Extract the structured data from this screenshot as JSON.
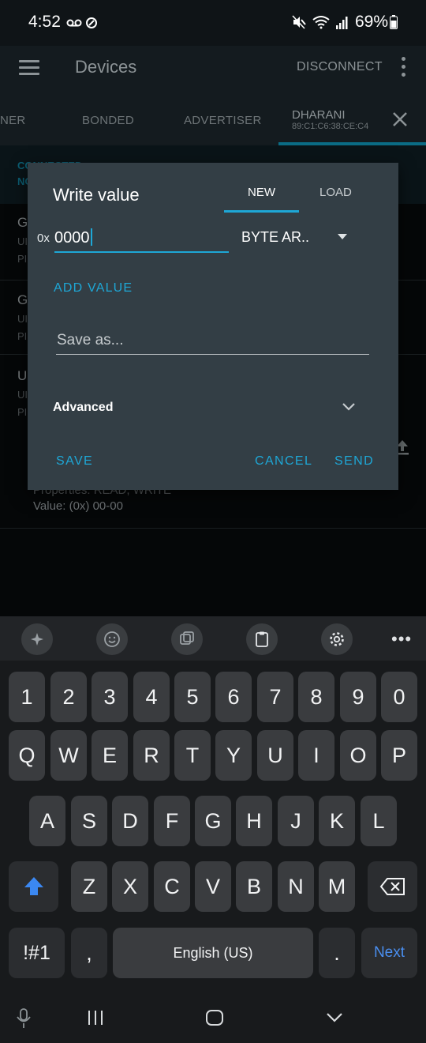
{
  "status_bar": {
    "time": "4:52",
    "battery": "69%"
  },
  "app_bar": {
    "title": "Devices",
    "disconnect_label": "DISCONNECT"
  },
  "tabs": {
    "tab1": "NER",
    "tab2": "BONDED",
    "tab3": "ADVERTISER",
    "active_name": "DHARANI",
    "active_mac": "89:C1:C6:38:CE:C4"
  },
  "background": {
    "conn1": "CONNECTED",
    "conn2": "NO",
    "row1_letter": "G",
    "row1_sub1": "UI",
    "row1_sub2": "PI",
    "row2_letter": "G",
    "row2_sub1": "UI",
    "row2_sub2": "PI",
    "row3_letter": "U",
    "row3_sub1": "UI",
    "row3_sub2": "PI",
    "props": "Properties: READ, WRITE",
    "value": "Value: (0x) 00-00"
  },
  "dialog": {
    "title": "Write value",
    "tab_new": "NEW",
    "tab_load": "LOAD",
    "prefix": "0x",
    "hex_value": "0000",
    "type_value": "BYTE AR..",
    "add_value": "ADD VALUE",
    "save_as_placeholder": "Save as...",
    "advanced": "Advanced",
    "save": "SAVE",
    "cancel": "CANCEL",
    "send": "SEND"
  },
  "keyboard": {
    "row_numbers": [
      "1",
      "2",
      "3",
      "4",
      "5",
      "6",
      "7",
      "8",
      "9",
      "0"
    ],
    "row_qwerty": [
      "Q",
      "W",
      "E",
      "R",
      "T",
      "Y",
      "U",
      "I",
      "O",
      "P"
    ],
    "row_asdf": [
      "A",
      "S",
      "D",
      "F",
      "G",
      "H",
      "J",
      "K",
      "L"
    ],
    "row_zxcv": [
      "Z",
      "X",
      "C",
      "V",
      "B",
      "N",
      "M"
    ],
    "symbols": "!#1",
    "comma": ",",
    "space": "English (US)",
    "period": ".",
    "next": "Next"
  },
  "colors": {
    "accent": "#1ea7d6",
    "dialog_bg": "#333e45",
    "next_key": "#4a8ff0"
  }
}
